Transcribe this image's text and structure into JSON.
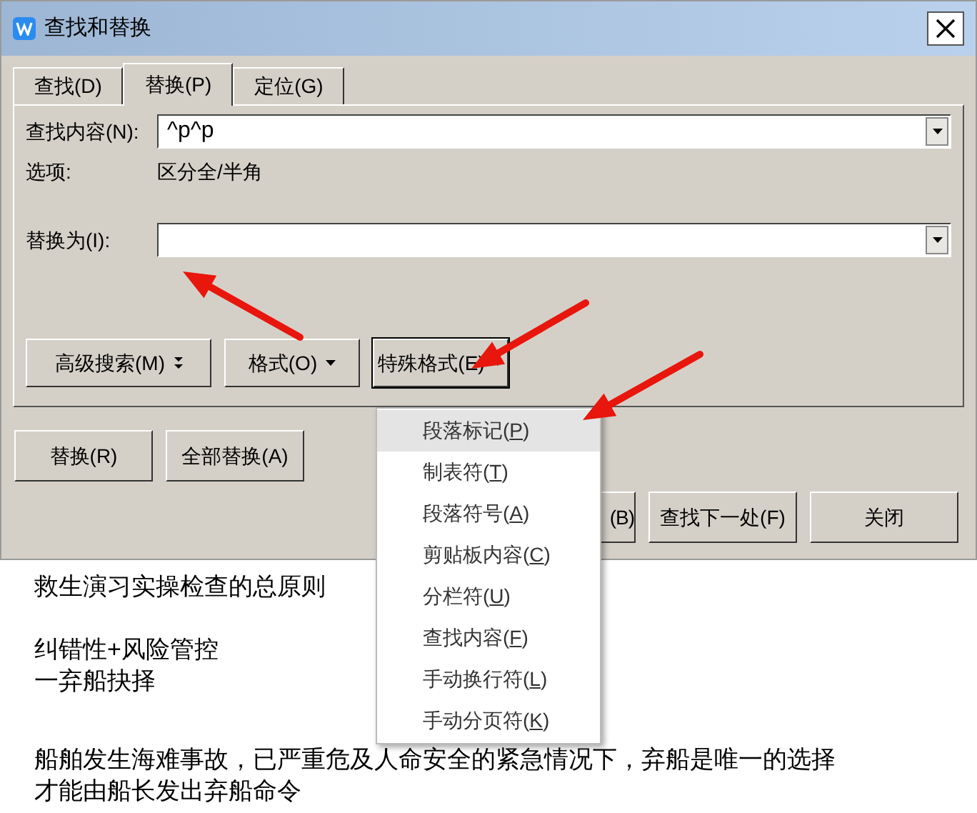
{
  "window": {
    "title": "查找和替换"
  },
  "tabs": [
    {
      "label": "查找(D)",
      "selected": false
    },
    {
      "label": "替换(P)",
      "selected": true
    },
    {
      "label": "定位(G)",
      "selected": false
    }
  ],
  "find": {
    "label": "查找内容(N):",
    "value": "^p^p"
  },
  "options": {
    "label": "选项:",
    "value": "区分全/半角"
  },
  "replace": {
    "label": "替换为(I):"
  },
  "panel_buttons": [
    {
      "label": "高级搜索(M)",
      "kind": "double_caret"
    },
    {
      "label": "格式(O)",
      "kind": "caret"
    },
    {
      "label": "特殊格式(E)",
      "kind": "caret"
    }
  ],
  "action_buttons": [
    "替换(R)",
    "全部替换(A)"
  ],
  "bottom_buttons": [
    "(B)",
    "查找下一处(F)",
    "关闭"
  ],
  "menu": [
    {
      "label": "段落标记(P)",
      "selected": true
    },
    {
      "label": "制表符(T)",
      "selected": false
    },
    {
      "label": "段落符号(A)",
      "selected": false
    },
    {
      "label": "剪贴板内容(C)",
      "selected": false
    },
    {
      "label": "分栏符(U)",
      "selected": false
    },
    {
      "label": "查找内容(F)",
      "selected": false
    },
    {
      "label": "手动换行符(L)",
      "selected": false
    },
    {
      "label": "手动分页符(K)",
      "selected": false
    }
  ],
  "document": [
    {
      "lines": [
        "救生演习实操检查的总原则"
      ]
    },
    {
      "lines": [
        "纠错性+风险管控",
        "一弃船抉择"
      ]
    },
    {
      "lines": [
        "船舶发生海难事故，已严重危及人命安全的紧急情况下，弃船是唯一的选择",
        "才能由船长发出弃船命令"
      ]
    }
  ]
}
